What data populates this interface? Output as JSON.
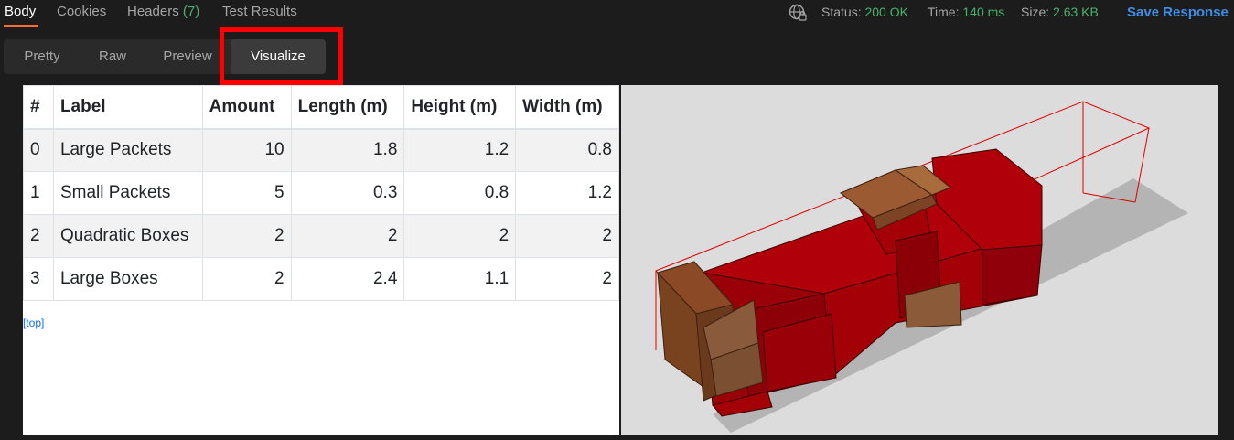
{
  "tabs": {
    "body": "Body",
    "cookies": "Cookies",
    "headers": "Headers",
    "headers_count": "(7)",
    "tests": "Test Results"
  },
  "status": {
    "status_label": "Status:",
    "status_value": "200 OK",
    "time_label": "Time:",
    "time_value": "140 ms",
    "size_label": "Size:",
    "size_value": "2.63 KB",
    "save_label": "Save Response"
  },
  "view_modes": {
    "pretty": "Pretty",
    "raw": "Raw",
    "preview": "Preview",
    "visualize": "Visualize"
  },
  "table": {
    "headers": [
      "#",
      "Label",
      "Amount",
      "Length (m)",
      "Height (m)",
      "Width (m)"
    ],
    "rows": [
      [
        "0",
        "Large Packets",
        "10",
        "1.8",
        "1.2",
        "0.8"
      ],
      [
        "1",
        "Small Packets",
        "5",
        "0.3",
        "0.8",
        "1.2"
      ],
      [
        "2",
        "Quadratic Boxes",
        "2",
        "2",
        "2",
        "2"
      ],
      [
        "3",
        "Large Boxes",
        "2",
        "2.4",
        "1.1",
        "2"
      ]
    ]
  },
  "top_link": "[top]",
  "colors": {
    "accent_orange": "#ff6c37",
    "status_green": "#49b26c",
    "save_blue": "#3f8fe8",
    "highlight_red": "#ff0000",
    "box_red": "#a30008",
    "box_brown": "#8b5a38"
  }
}
